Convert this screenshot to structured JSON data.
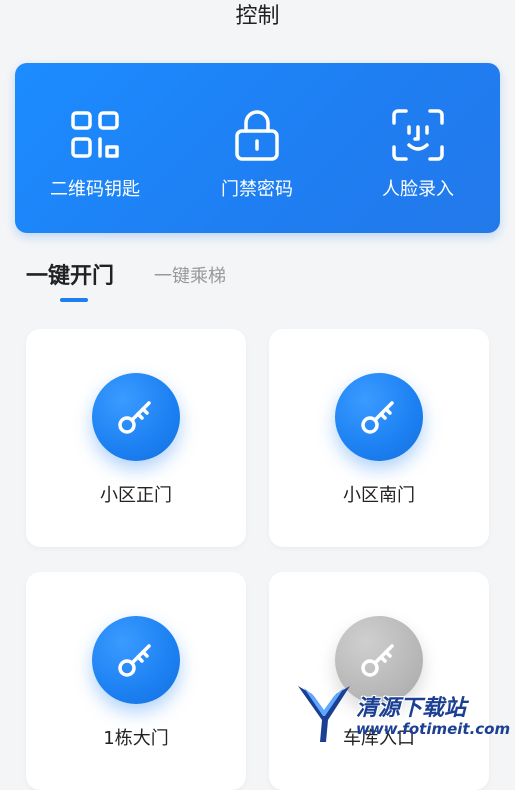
{
  "header": {
    "title": "控制"
  },
  "banner": {
    "items": [
      {
        "label": "二维码钥匙",
        "icon": "qr-code-icon"
      },
      {
        "label": "门禁密码",
        "icon": "lock-icon"
      },
      {
        "label": "人脸录入",
        "icon": "face-scan-icon"
      }
    ],
    "color": "#1e7ef2"
  },
  "tabs": {
    "active": "一键开门",
    "inactive": "一键乘梯"
  },
  "doors": [
    {
      "label": "小区正门",
      "icon": "key-icon",
      "status": "active"
    },
    {
      "label": "小区南门",
      "icon": "key-icon",
      "status": "active"
    },
    {
      "label": "1栋大门",
      "icon": "key-icon",
      "status": "active"
    },
    {
      "label": "车库入口",
      "icon": "key-icon",
      "status": "inactive"
    }
  ],
  "watermark": {
    "name": "清源下载站",
    "url": "www.fotimeit.com"
  }
}
